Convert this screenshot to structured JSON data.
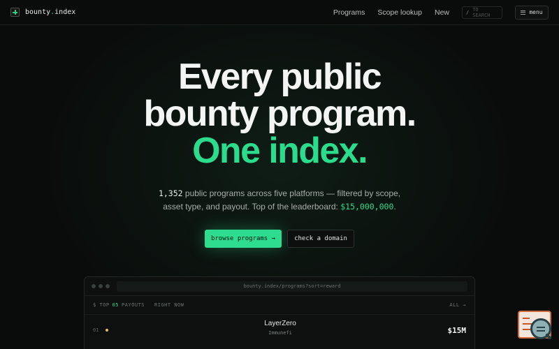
{
  "nav": {
    "brand_prefix": "bounty",
    "brand_dot": ".",
    "brand_suffix": "index",
    "links": [
      "Programs",
      "Scope lookup",
      "New"
    ],
    "search_key": "/",
    "search_hint": "TO SEARCH",
    "menu_label": "menu"
  },
  "hero": {
    "line1": "Every public",
    "line2": "bounty program.",
    "line3": "One index."
  },
  "subtitle": {
    "count": "1,352",
    "text1": " public programs across five platforms — filtered by scope,",
    "text2": "asset type, and payout. Top of the leaderboard: ",
    "top_reward": "$15,000,000",
    "end": "."
  },
  "cta": {
    "primary": "browse programs →",
    "secondary": "check a domain"
  },
  "panel": {
    "url": "bounty.index/programs?sort=reward",
    "head_prefix": "$ TOP",
    "head_count": "05",
    "head_label": "PAYOUTS",
    "head_status": "RIGHT NOW",
    "head_all": "ALL →",
    "rows": [
      {
        "rank": "01",
        "name": "LayerZero",
        "platform": "Immunefi",
        "reward": "$15M"
      }
    ]
  },
  "colors": {
    "accent": "#2bdc8d",
    "background": "#0a0c0b",
    "rank_dot": "#e6c34a"
  }
}
